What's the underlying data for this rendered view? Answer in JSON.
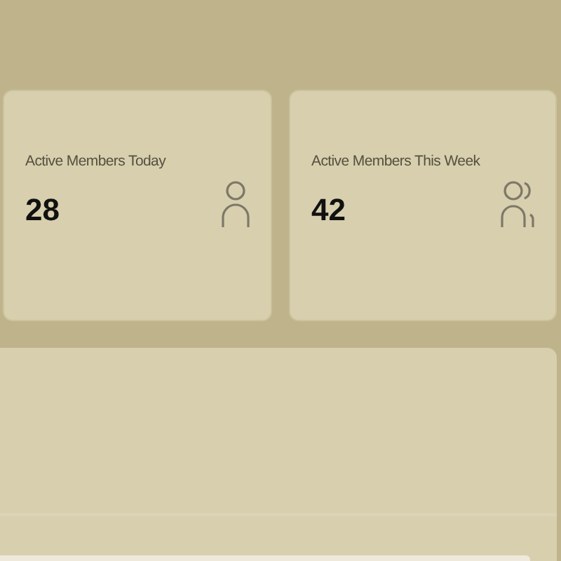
{
  "stats": [
    {
      "label": "Active Members Today",
      "value": "28",
      "kind": "single"
    },
    {
      "label": "Active Members This Week",
      "value": "42",
      "kind": "group"
    }
  ]
}
